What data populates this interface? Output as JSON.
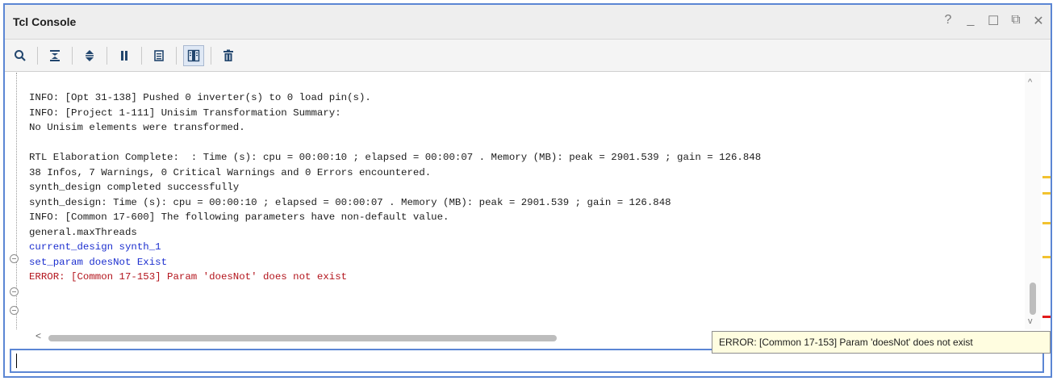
{
  "panel": {
    "title": "Tcl Console",
    "controls": [
      {
        "name": "help",
        "glyph": "?"
      },
      {
        "name": "minimize",
        "glyph": "_"
      },
      {
        "name": "maximize",
        "glyph": "☐"
      },
      {
        "name": "float",
        "glyph": "⧉"
      },
      {
        "name": "close",
        "glyph": "✕"
      }
    ]
  },
  "toolbar": {
    "buttons": [
      "search-icon",
      "collapse-all-icon",
      "expand-all-icon",
      "pause-icon",
      "copy-icon",
      "show-columns-icon",
      "clear-icon"
    ]
  },
  "output": {
    "lines": [
      {
        "text": "INFO: [Opt 31-138] Pushed 0 inverter(s) to 0 load pin(s).",
        "style": "normal"
      },
      {
        "text": "INFO: [Project 1-111] Unisim Transformation Summary:",
        "style": "normal"
      },
      {
        "text": "No Unisim elements were transformed.",
        "style": "normal"
      },
      {
        "text": "",
        "style": "normal"
      },
      {
        "text": "RTL Elaboration Complete:  : Time (s): cpu = 00:00:10 ; elapsed = 00:00:07 . Memory (MB): peak = 2901.539 ; gain = 126.848",
        "style": "normal"
      },
      {
        "text": "38 Infos, 7 Warnings, 0 Critical Warnings and 0 Errors encountered.",
        "style": "normal"
      },
      {
        "text": "synth_design completed successfully",
        "style": "normal"
      },
      {
        "text": "synth_design: Time (s): cpu = 00:00:10 ; elapsed = 00:00:07 . Memory (MB): peak = 2901.539 ; gain = 126.848",
        "style": "normal"
      },
      {
        "text": "INFO: [Common 17-600] The following parameters have non-default value.",
        "style": "normal"
      },
      {
        "text": "general.maxThreads",
        "style": "normal"
      },
      {
        "text": "current_design synth_1",
        "style": "blue"
      },
      {
        "text": "set_param doesNot Exist",
        "style": "blue"
      },
      {
        "text": "ERROR: [Common 17-153] Param 'doesNot' does not exist",
        "style": "red"
      }
    ]
  },
  "tooltip": {
    "text": "ERROR: [Common 17-153] Param 'doesNot' does not exist"
  },
  "colors": {
    "accent": "#5b86d4",
    "command": "#1c2fcf",
    "error": "#b3141c",
    "warning_marker": "#f2c230",
    "error_marker": "#e11b1b"
  }
}
